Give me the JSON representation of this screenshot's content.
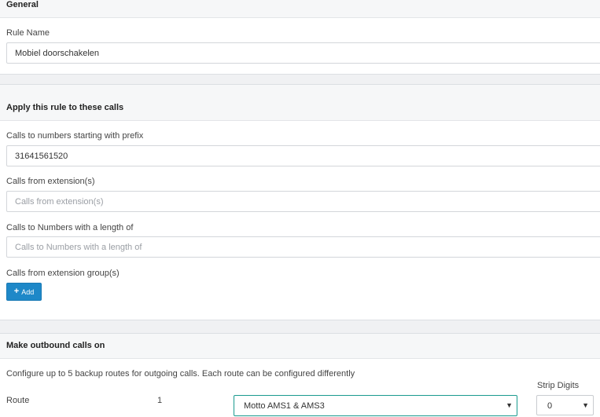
{
  "general": {
    "heading": "General",
    "rule_name_label": "Rule Name",
    "rule_name_value": "Mobiel doorschakelen"
  },
  "apply": {
    "heading": "Apply this rule to these calls",
    "prefix_label": "Calls to numbers starting with prefix",
    "prefix_value": "31641561520",
    "from_ext_label": "Calls from extension(s)",
    "from_ext_placeholder": "Calls from extension(s)",
    "length_label": "Calls to Numbers with a length of",
    "length_placeholder": "Calls to Numbers with a length of",
    "ext_group_label": "Calls from extension group(s)",
    "add_button": "Add"
  },
  "outbound": {
    "heading": "Make outbound calls on",
    "description": "Configure up to 5 backup routes for outgoing calls. Each route can be configured differently",
    "route_label": "Route",
    "route_number": "1",
    "route_selected": "Motto AMS1 & AMS3",
    "strip_digits_label": "Strip Digits",
    "strip_digits_value": "0"
  },
  "colors": {
    "accent": "#1e88c8",
    "route_select_border": "#1a9a8f"
  },
  "icons": {
    "add": "plus-icon",
    "dropdown": "caret-down-icon"
  }
}
